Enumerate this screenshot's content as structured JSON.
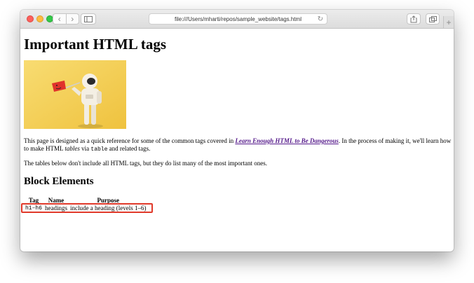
{
  "browser": {
    "url": "file:///Users/mharti/repos/sample_website/tags.html",
    "back_icon": "chevron-left-icon",
    "forward_icon": "chevron-right-icon"
  },
  "page": {
    "title": "Important HTML tags",
    "hero_image_alt": "astronaut holding a red flag",
    "intro": {
      "text_before_link": "This page is designed as a quick reference for some of the common tags covered in ",
      "link_text": "Learn Enough HTML to Be Dangerous",
      "text_after_link": ". In the process of making it, we'll learn how to make HTML ",
      "tables_word": "tables",
      "via_text": " via ",
      "table_code": "table",
      "end_text": " and related tags."
    },
    "note": "The tables below don't include all HTML tags, but they do list many of the most important ones.",
    "section_heading": "Block Elements",
    "table": {
      "headers": [
        "Tag",
        "Name",
        "Purpose"
      ],
      "rows": [
        {
          "tag": "h1–h6",
          "name": "headings",
          "purpose": "include a heading (levels 1–6)"
        }
      ]
    }
  },
  "colors": {
    "highlight_border": "#e0392a",
    "link": "#551a8b",
    "hero_background": "#f2c94c"
  }
}
